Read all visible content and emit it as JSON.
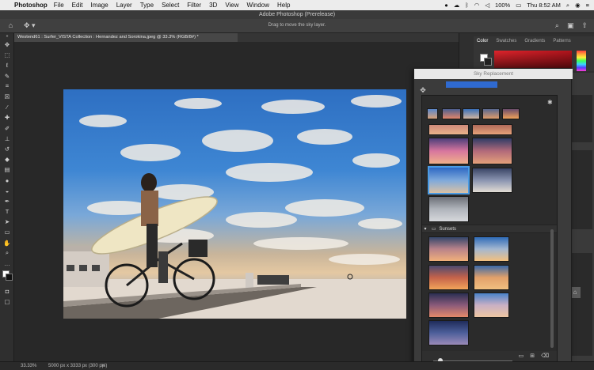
{
  "menubar": {
    "app": "Photoshop",
    "menus": [
      "File",
      "Edit",
      "Image",
      "Layer",
      "Type",
      "Select",
      "Filter",
      "3D",
      "View",
      "Window",
      "Help"
    ],
    "battery": "100%",
    "clock": "Thu 8:52 AM"
  },
  "window": {
    "title": "Adobe Photoshop (Prerelease)"
  },
  "options": {
    "hint": "Drag to move the sky layer."
  },
  "document": {
    "tab": "Westend61 : Surfer_VISTA Collection : Hernandez and Sorokina.jpeg @ 33.3% (RGB/8#) *"
  },
  "colorpanel": {
    "tabs": [
      "Color",
      "Swatches",
      "Gradients",
      "Patterns"
    ]
  },
  "skydialog": {
    "title": "Sky Replacement",
    "group": "Sunsets"
  },
  "status": {
    "zoom": "33.33%",
    "dims": "5000 px x 3333 px (300 ppi)",
    "arrow": ">"
  },
  "icons": {
    "tools": [
      "move-icon",
      "marquee-icon",
      "lasso-icon",
      "quick-select-icon",
      "crop-icon",
      "frame-icon",
      "eyedropper-icon",
      "healing-icon",
      "brush-icon",
      "stamp-icon",
      "history-brush-icon",
      "eraser-icon",
      "gradient-icon",
      "blur-icon",
      "dodge-icon",
      "pen-icon",
      "type-icon",
      "path-select-icon",
      "rectangle-icon",
      "hand-icon",
      "zoom-icon",
      "more-tools-icon"
    ]
  }
}
